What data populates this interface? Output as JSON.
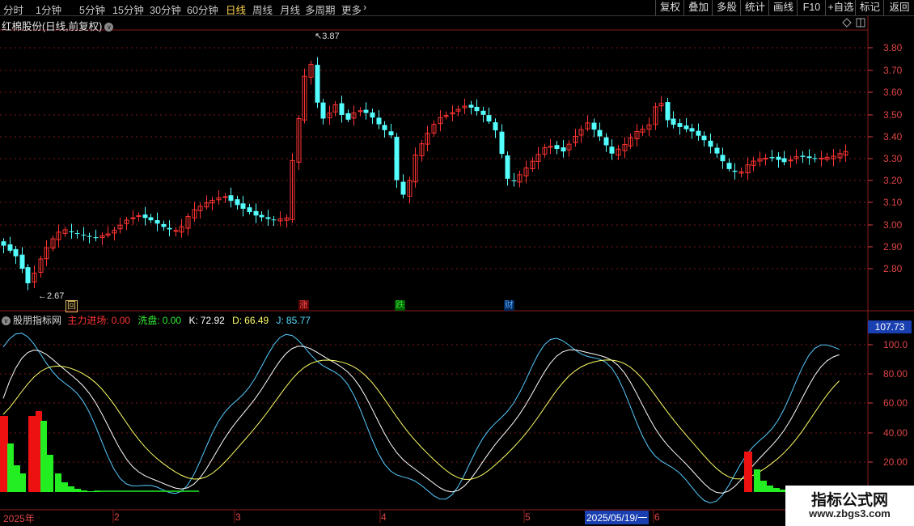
{
  "toolbar": {
    "periods": [
      "分时",
      "1分钟",
      "5分钟",
      "15分钟",
      "30分钟",
      "60分钟",
      "日线",
      "周线",
      "月线",
      "多周期",
      "更多"
    ],
    "active_period": "日线",
    "tools": [
      "复权",
      "叠加",
      "多股",
      "统计",
      "画线",
      "F10",
      "+自选",
      "标记",
      "返回"
    ]
  },
  "main_chart": {
    "title": "红棉股份(日线,前复权)",
    "price_labels": [
      "3.80",
      "3.70",
      "3.60",
      "3.50",
      "3.40",
      "3.30",
      "3.20",
      "3.10",
      "3.00",
      "2.90",
      "2.80"
    ],
    "high_label": "3.87",
    "low_label": "2.67",
    "markers": [
      {
        "text": "回",
        "color": "#e0c060"
      },
      {
        "text": "涨",
        "color": "#ff5555"
      },
      {
        "text": "跌",
        "color": "#33dd33"
      },
      {
        "text": "财",
        "color": "#55aaff"
      }
    ]
  },
  "indicator": {
    "name": "股朋指标网",
    "items": [
      {
        "label": "主力进场:",
        "value": "0.00",
        "color": "#ff3333"
      },
      {
        "label": "洗盘:",
        "value": "0.00",
        "color": "#33ee33"
      },
      {
        "label": "K:",
        "value": "72.92",
        "color": "#ffffff"
      },
      {
        "label": "D:",
        "value": "66.49",
        "color": "#ffff66"
      },
      {
        "label": "J:",
        "value": "85.77",
        "color": "#55ddff"
      }
    ],
    "axis_labels": [
      "100.0",
      "80.00",
      "60.00",
      "40.00",
      "20.00"
    ],
    "current_badge": "107.73"
  },
  "time_axis": {
    "labels": [
      "2025年",
      "2",
      "3",
      "4",
      "5",
      "2025/05/19/一",
      "6"
    ]
  },
  "watermark": {
    "title": "指标公式网",
    "url": "www.zbgs3.com"
  },
  "colors": {
    "up": "#ff3333",
    "down": "#54ffff",
    "k_line": "#ffffff",
    "d_line": "#ffff66",
    "j_line": "#55ccff",
    "grid": "#7a1a1a"
  }
}
